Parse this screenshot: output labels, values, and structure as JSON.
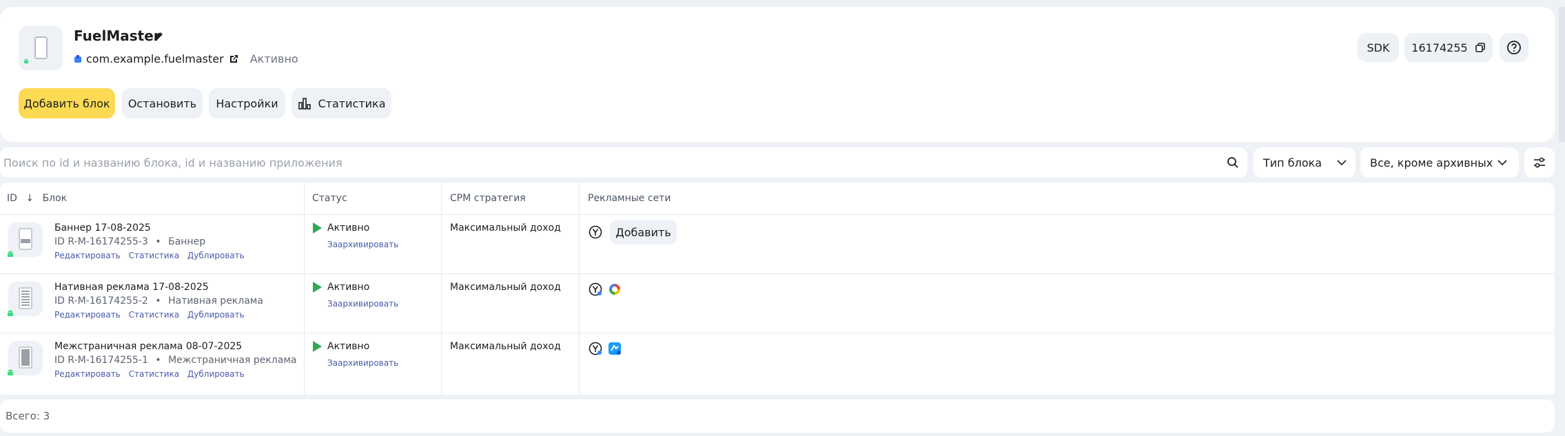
{
  "app": {
    "name": "FuelMaster",
    "package": "com.example.fuelmaster",
    "status": "Активно",
    "sdk_label": "SDK",
    "app_id": "16174255"
  },
  "actions": {
    "add_block": "Добавить блок",
    "stop": "Остановить",
    "settings": "Настройки",
    "statistics": "Статистика"
  },
  "search": {
    "placeholder": "Поиск по id и названию блока, id и названию приложения"
  },
  "filters": {
    "block_type": "Тип блока",
    "archive_filter": "Все, кроме архивных"
  },
  "table": {
    "headers": {
      "id": "ID",
      "sort_arrow": "↓",
      "block": "Блок",
      "status": "Статус",
      "cpm": "CPM стратегия",
      "networks": "Рекламные сети"
    },
    "link_edit": "Редактировать",
    "link_stats": "Статистика",
    "link_duplicate": "Дублировать",
    "link_archive": "Заархивировать",
    "rows": [
      {
        "name": "Баннер 17-08-2025",
        "block_id": "ID R-M-16174255-3",
        "type": "Баннер",
        "status": "Активно",
        "strategy": "Максимальный доход",
        "add_label": "Добавить"
      },
      {
        "name": "Нативная реклама 17-08-2025",
        "block_id": "ID R-M-16174255-2",
        "type": "Нативная реклама",
        "status": "Активно",
        "strategy": "Максимальный доход"
      },
      {
        "name": "Межстраничная реклама 08-07-2025",
        "block_id": "ID R-M-16174255-1",
        "type": "Межстраничная реклама",
        "status": "Активно",
        "strategy": "Максимальный доход"
      }
    ]
  },
  "footer": {
    "total": "Всего: 3"
  },
  "colors": {
    "primary_button": "#fcda53",
    "status_active": "#34a853",
    "link": "#4a5aa8"
  }
}
